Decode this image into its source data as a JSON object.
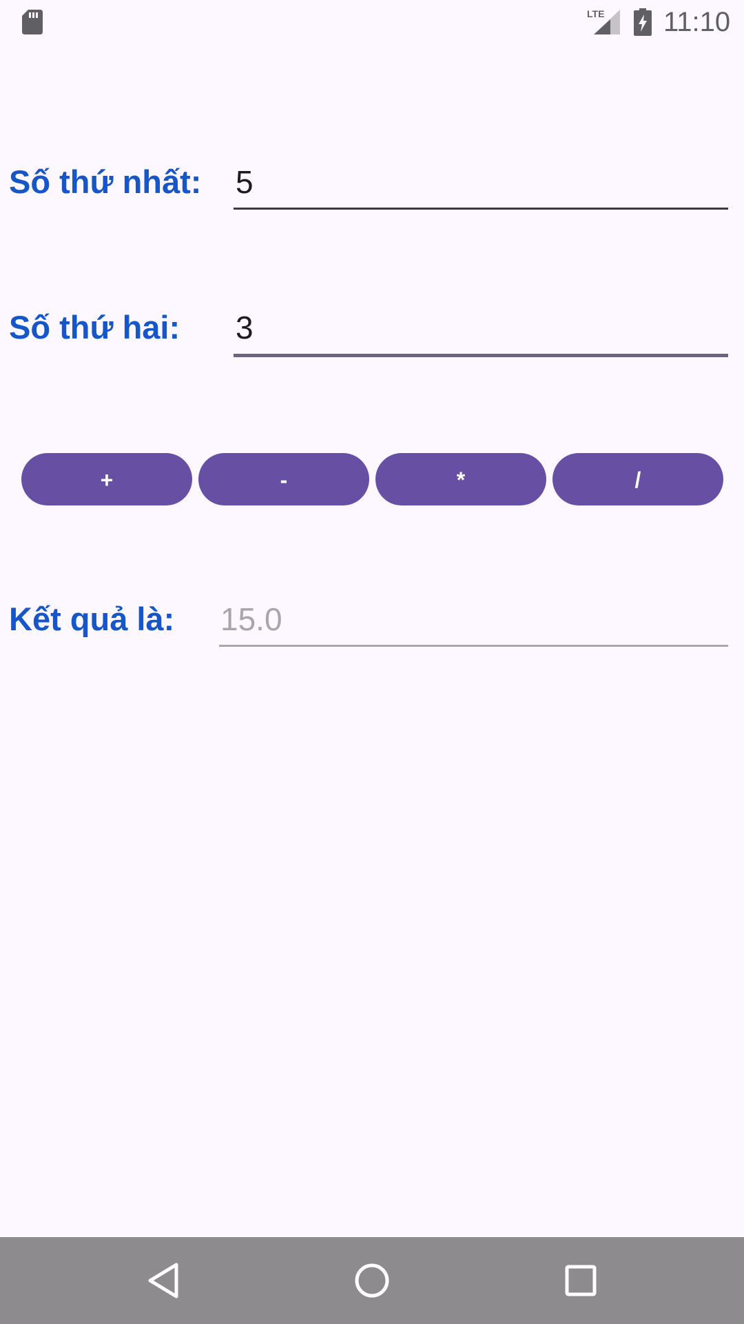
{
  "status_bar": {
    "time": "11:10",
    "network": "LTE",
    "icons": [
      "sd-card-icon",
      "lte-signal-icon",
      "battery-charging-icon"
    ]
  },
  "form": {
    "first_label": "Số thứ nhất:",
    "first_value": "5",
    "second_label": "Số thứ hai:",
    "second_value": "3",
    "result_label": "Kết quả là:",
    "result_value": "15.0"
  },
  "operations": {
    "add": "+",
    "subtract": "-",
    "multiply": "*",
    "divide": "/"
  },
  "nav_bar": {
    "icons": [
      "back-icon",
      "home-icon",
      "recents-icon"
    ]
  },
  "colors": {
    "background": "#FDF7FF",
    "label": "#1556C9",
    "button": "#6750A4",
    "nav_bar": "#8D8B8E"
  }
}
